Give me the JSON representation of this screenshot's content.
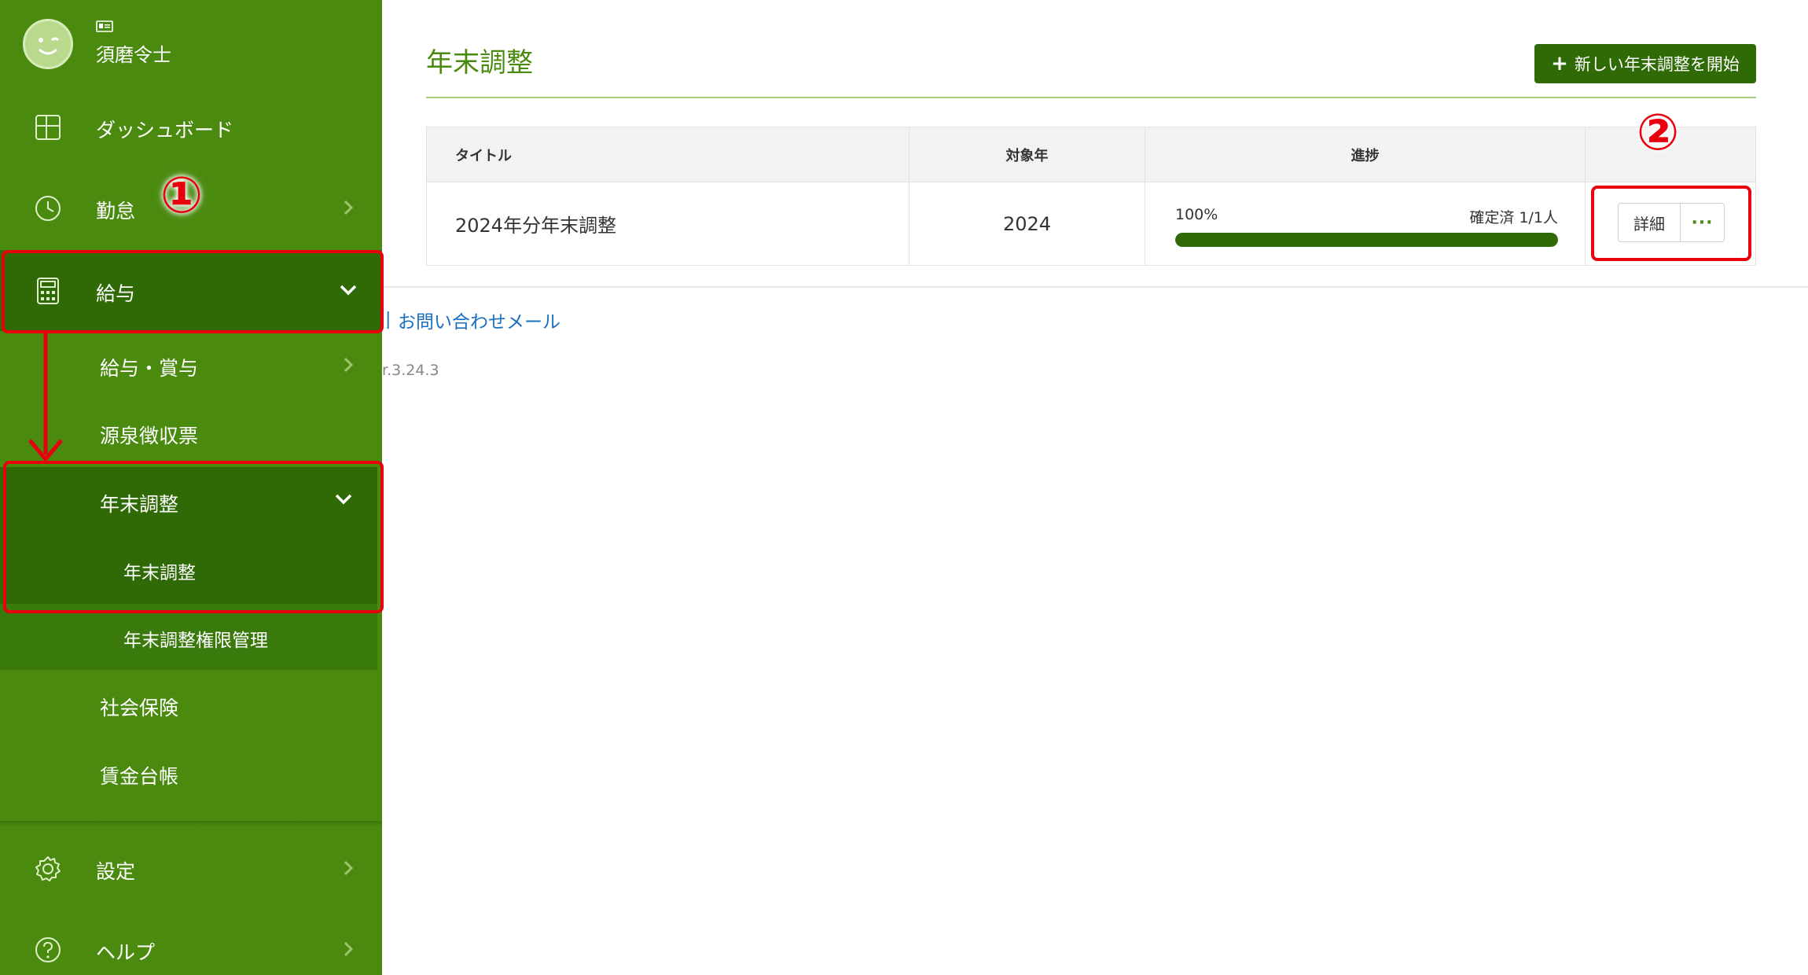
{
  "user": {
    "name": "須磨令士",
    "avatar": "smiley-avatar",
    "badge_icon": "id-card-icon"
  },
  "sidebar": {
    "items": [
      {
        "label": "ダッシュボード",
        "icon": "dashboard-grid-icon"
      },
      {
        "label": "勤怠",
        "icon": "clock-icon"
      },
      {
        "label": "給与",
        "icon": "calculator-icon"
      },
      {
        "label": "設定",
        "icon": "gear-icon"
      },
      {
        "label": "ヘルプ",
        "icon": "help-circle-icon"
      }
    ],
    "salary_sub": [
      {
        "label": "給与・賞与"
      },
      {
        "label": "源泉徴収票"
      },
      {
        "label": "年末調整"
      },
      {
        "label": "社会保険"
      },
      {
        "label": "賃金台帳"
      }
    ],
    "yearend_sub": [
      {
        "label": "年末調整"
      },
      {
        "label": "年末調整権限管理"
      }
    ]
  },
  "annotations": {
    "step1": "①",
    "step2": "②"
  },
  "main": {
    "title": "年末調整",
    "new_button": "新しい年末調整を開始",
    "table": {
      "headers": [
        "タイトル",
        "対象年",
        "進捗",
        ""
      ],
      "rows": [
        {
          "title": "2024年分年末調整",
          "year": "2024",
          "progress_label": "100%",
          "progress": 1.0,
          "status": "確定済 1/1人",
          "detail": "詳細",
          "more": "···"
        }
      ]
    },
    "footer": {
      "separator": "|",
      "contact": "お問い合わせメール",
      "version": "r.3.24.3"
    }
  },
  "colors": {
    "sidebar": "#4a8a0f",
    "active": "#2f6a06",
    "accent": "#e8000f",
    "link": "#1a6fc0"
  }
}
